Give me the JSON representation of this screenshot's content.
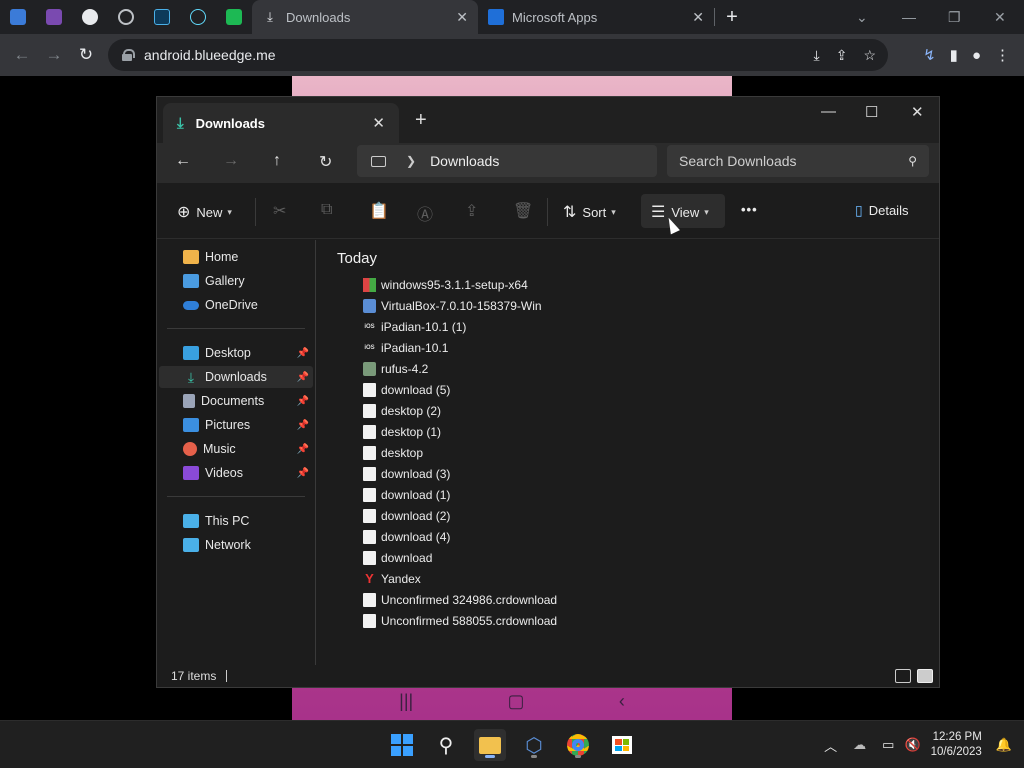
{
  "browser": {
    "tabs": [
      {
        "title": "Downloads",
        "icon": "download-icon"
      },
      {
        "title": "Microsoft Apps",
        "icon": "microsoft-store-icon"
      }
    ],
    "new_tab": "+",
    "url": "android.blueedge.me"
  },
  "explorer": {
    "tab_title": "Downloads",
    "new_tab": "+",
    "breadcrumb": "Downloads",
    "search_placeholder": "Search Downloads",
    "commands": {
      "new": "New",
      "sort": "Sort",
      "view": "View",
      "more": "•••",
      "details": "Details"
    },
    "sidebar": {
      "quick": [
        {
          "label": "Home",
          "color": "#f0b34a"
        },
        {
          "label": "Gallery",
          "color": "#4a9be0"
        },
        {
          "label": "OneDrive",
          "color": "#2f7fd8"
        }
      ],
      "pinned": [
        {
          "label": "Desktop",
          "color": "#39a0e0"
        },
        {
          "label": "Downloads",
          "color": "#3ac2a8"
        },
        {
          "label": "Documents",
          "color": "#9aa4b8"
        },
        {
          "label": "Pictures",
          "color": "#3b8fe0"
        },
        {
          "label": "Music",
          "color": "#e5604a"
        },
        {
          "label": "Videos",
          "color": "#8a4ad8"
        }
      ],
      "locations": [
        {
          "label": "This PC",
          "color": "#4ab0e8"
        },
        {
          "label": "Network",
          "color": "#4ab0e8"
        }
      ]
    },
    "group_header": "Today",
    "files": [
      {
        "name": "windows95-3.1.1-setup-x64",
        "type": "win"
      },
      {
        "name": "VirtualBox-7.0.10-158379-Win",
        "type": "vb"
      },
      {
        "name": "iPadian-10.1 (1)",
        "type": "ios"
      },
      {
        "name": "iPadian-10.1",
        "type": "ios"
      },
      {
        "name": "rufus-4.2",
        "type": "rufus"
      },
      {
        "name": "download (5)",
        "type": "doc"
      },
      {
        "name": "desktop (2)",
        "type": "doc"
      },
      {
        "name": "desktop (1)",
        "type": "doc"
      },
      {
        "name": "desktop",
        "type": "doc"
      },
      {
        "name": "download (3)",
        "type": "doc"
      },
      {
        "name": "download (1)",
        "type": "doc"
      },
      {
        "name": "download (2)",
        "type": "doc"
      },
      {
        "name": "download (4)",
        "type": "doc"
      },
      {
        "name": "download",
        "type": "doc"
      },
      {
        "name": "Yandex",
        "type": "yandex"
      },
      {
        "name": "Unconfirmed 324986.crdownload",
        "type": "doc"
      },
      {
        "name": "Unconfirmed 588055.crdownload",
        "type": "doc"
      }
    ],
    "status_count": "17 items"
  },
  "taskbar": {
    "time": "12:26 PM",
    "date": "10/6/2023"
  },
  "colors": {
    "accent": "#3ac2a8",
    "explorer_bg": "#1c1c1c",
    "taskbar_bg": "#202020"
  }
}
